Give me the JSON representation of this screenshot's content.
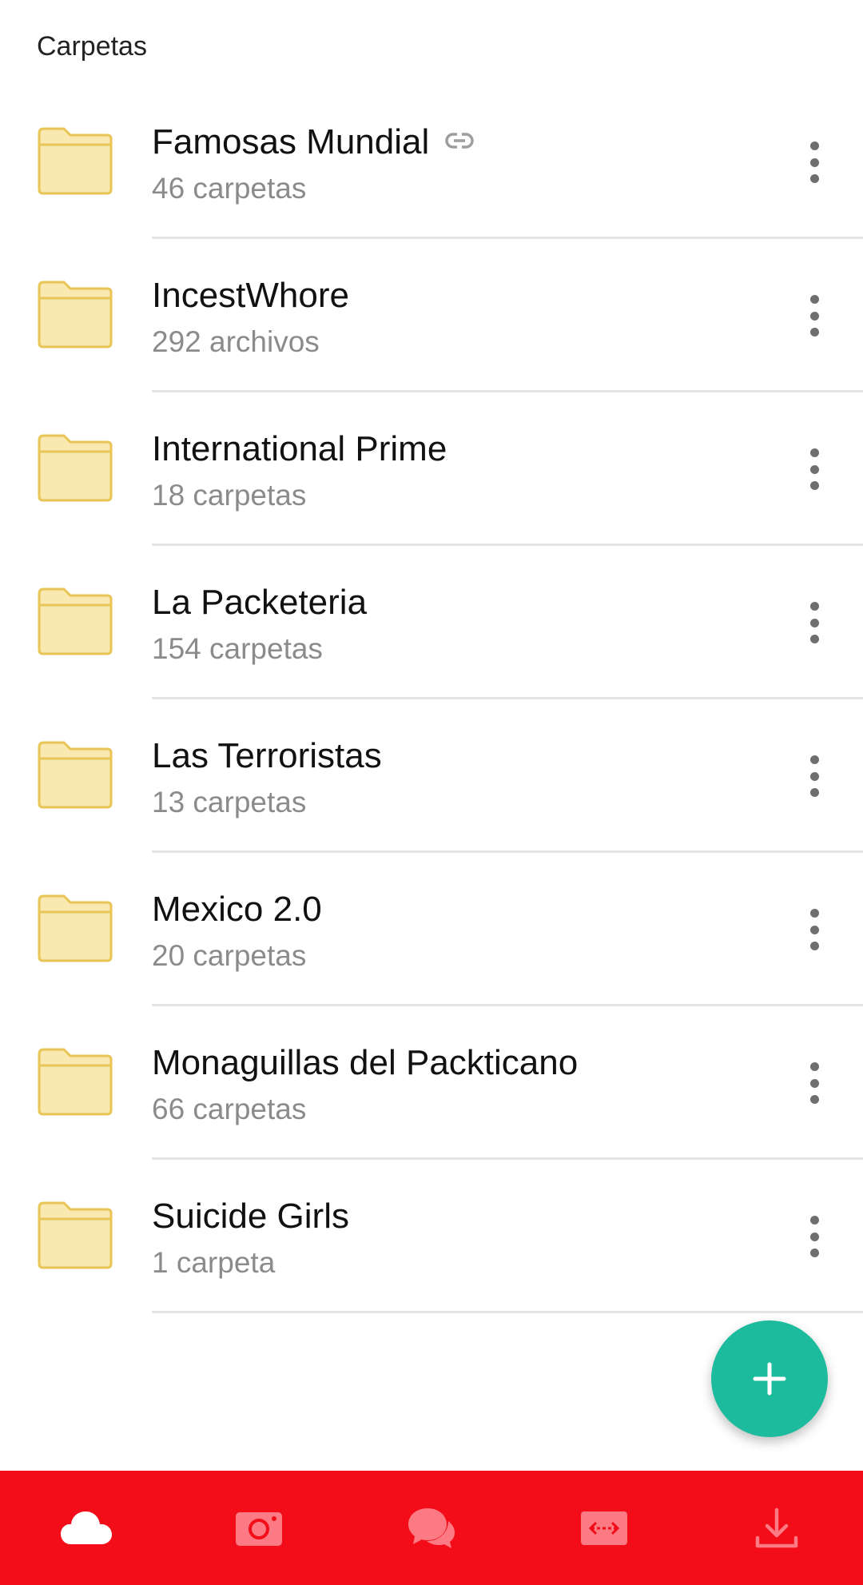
{
  "header": {
    "title": "Carpetas"
  },
  "folders": [
    {
      "name": "Famosas Mundial",
      "subtitle": "46 carpetas",
      "shared_link": true
    },
    {
      "name": "IncestWhore",
      "subtitle": "292 archivos",
      "shared_link": false
    },
    {
      "name": "International Prime",
      "subtitle": "18 carpetas",
      "shared_link": false
    },
    {
      "name": "La Packeteria",
      "subtitle": "154 carpetas",
      "shared_link": false
    },
    {
      "name": "Las Terroristas",
      "subtitle": "13 carpetas",
      "shared_link": false
    },
    {
      "name": "Mexico 2.0",
      "subtitle": "20 carpetas",
      "shared_link": false
    },
    {
      "name": "Monaguillas del Packticano",
      "subtitle": "66 carpetas",
      "shared_link": false
    },
    {
      "name": "Suicide Girls",
      "subtitle": "1 carpeta",
      "shared_link": false
    }
  ],
  "fab": {
    "icon": "plus-icon"
  },
  "bottom_nav": {
    "items": [
      {
        "icon": "cloud-icon",
        "active": true
      },
      {
        "icon": "camera-icon",
        "active": false
      },
      {
        "icon": "chat-icon",
        "active": false
      },
      {
        "icon": "transfer-icon",
        "active": false
      },
      {
        "icon": "download-icon",
        "active": false
      }
    ]
  },
  "colors": {
    "nav_background": "#f20d18",
    "fab_background": "#1dbb9e",
    "folder_fill": "#f9e8b0",
    "folder_stroke": "#e8c554",
    "nav_icon_active": "#ffffff",
    "nav_icon_inactive": "#fb7a83"
  }
}
